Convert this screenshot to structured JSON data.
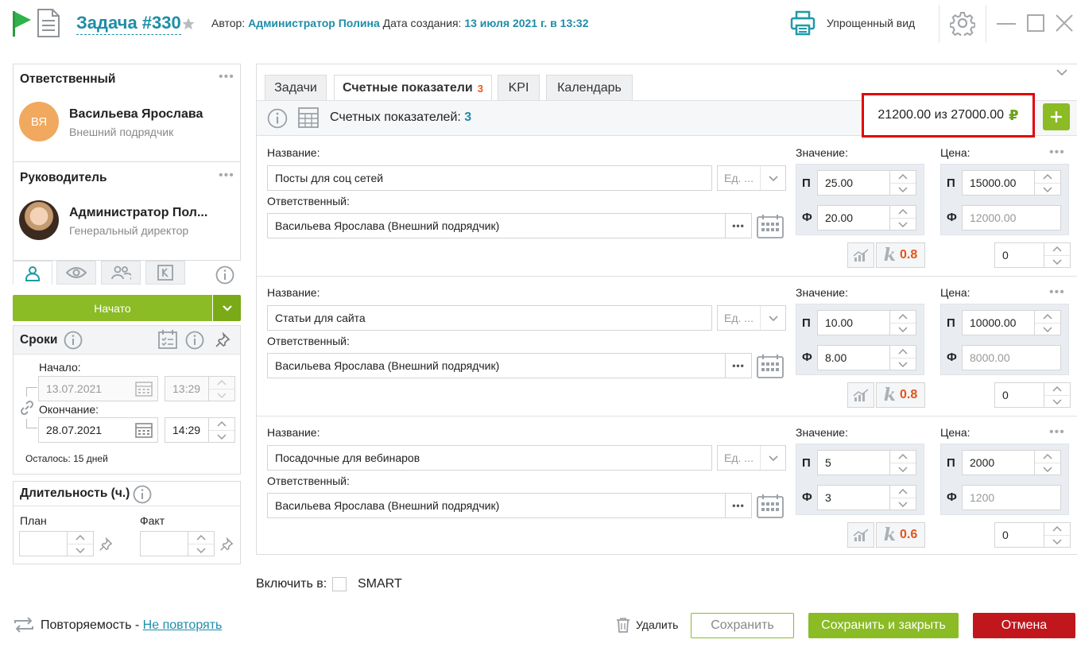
{
  "header": {
    "title": "Задача #330",
    "author_label": "Автор:",
    "author": "Администратор Полина",
    "created_label": "Дата создания:",
    "created": "13 июля 2021 г. в 13:32",
    "simple_view": "Упрощенный вид"
  },
  "responsible": {
    "title": "Ответственный",
    "initials": "ВЯ",
    "name": "Васильева Ярослава",
    "role": "Внешний подрядчик"
  },
  "manager": {
    "title": "Руководитель",
    "name": "Администратор Пол...",
    "role": "Генеральный директор"
  },
  "status": {
    "label": "Начато"
  },
  "deadlines": {
    "title": "Сроки",
    "start_label": "Начало:",
    "start_date": "13.07.2021",
    "start_time": "13:29",
    "end_label": "Окончание:",
    "end_date": "28.07.2021",
    "end_time": "14:29",
    "remaining": "Осталось: 15 дней"
  },
  "duration": {
    "title": "Длительность (ч.)",
    "plan_label": "План",
    "fact_label": "Факт"
  },
  "tabs": [
    {
      "label": "Задачи"
    },
    {
      "label": "Счетные показатели",
      "count": "3"
    },
    {
      "label": "KPI"
    },
    {
      "label": "Календарь"
    }
  ],
  "toolbar": {
    "count_label": "Счетных показателей:",
    "count": "3",
    "summary": "21200.00 из 27000.00",
    "currency": "₽"
  },
  "labels": {
    "name": "Название:",
    "responsible": "Ответственный:",
    "value": "Значение:",
    "price": "Цена:",
    "plan": "П",
    "fact": "Ф",
    "unit_placeholder": "Ед. ...",
    "k": "k"
  },
  "indicators": [
    {
      "name": "Посты для соц сетей",
      "responsible": "Васильева Ярослава (Внешний подрядчик)",
      "value_plan": "25.00",
      "value_fact": "20.00",
      "k": "0.8",
      "price_plan": "15000.00",
      "price_fact": "12000.00",
      "extra": "0"
    },
    {
      "name": "Статьи для сайта",
      "responsible": "Васильева Ярослава (Внешний подрядчик)",
      "value_plan": "10.00",
      "value_fact": "8.00",
      "k": "0.8",
      "price_plan": "10000.00",
      "price_fact": "8000.00",
      "extra": "0"
    },
    {
      "name": "Посадочные для вебинаров",
      "responsible": "Васильева Ярослава (Внешний подрядчик)",
      "value_plan": "5",
      "value_fact": "3",
      "k": "0.6",
      "price_plan": "2000",
      "price_fact": "1200",
      "extra": "0"
    }
  ],
  "include": {
    "label": "Включить в:",
    "option": "SMART"
  },
  "footer": {
    "repeat_label": "Повторяемость -",
    "repeat_value": "Не повторять",
    "delete": "Удалить",
    "save": "Сохранить",
    "save_close": "Сохранить и закрыть",
    "cancel": "Отмена"
  },
  "colors": {
    "accent": "#1e8da8",
    "green": "#8bbb25",
    "red": "#c0161c",
    "orange": "#e4541c"
  }
}
